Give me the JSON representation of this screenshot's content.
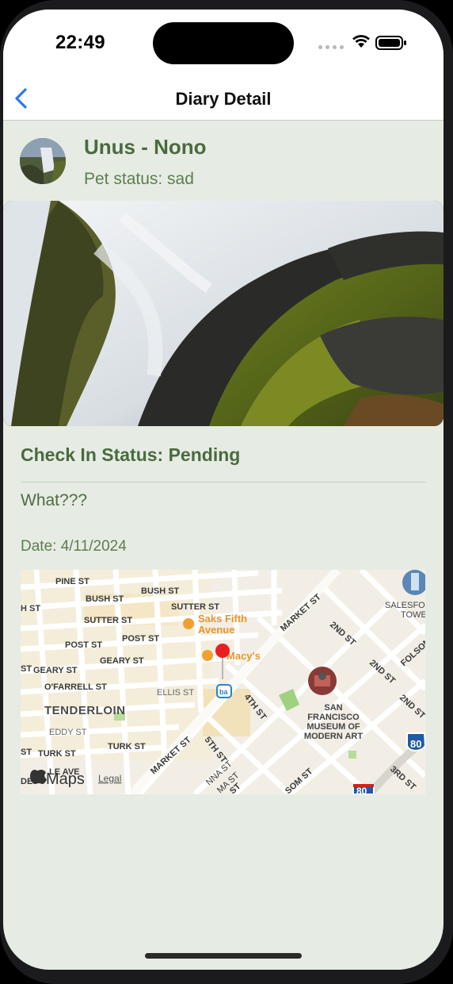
{
  "status_bar": {
    "time": "22:49",
    "icons": [
      "cellular-signal-icon",
      "wifi-icon",
      "battery-icon"
    ]
  },
  "nav": {
    "title": "Diary Detail",
    "back_icon": "chevron-left-icon",
    "accent": "#2a7be4"
  },
  "diary": {
    "owner_title": "Unus - Nono",
    "pet_status": "Pet status: sad",
    "check_in_status": "Check In Status: Pending",
    "note": "What???",
    "date": "Date: 4/11/2024"
  },
  "map": {
    "streets": [
      "PINE ST",
      "BUSH ST",
      "BUSH ST",
      "SUTTER ST",
      "SUTTER ST",
      "POST ST",
      "POST ST",
      "GEARY ST",
      "GEARY ST",
      "O'FARRELL ST",
      "ELLIS ST",
      "EDDY ST",
      "TURK ST",
      "TURK ST",
      "MARKET ST",
      "MARKET ST",
      "2ND ST",
      "2ND ST",
      "2ND ST",
      "4TH ST",
      "5TH ST",
      "3RD ST",
      "FOLSOM",
      "SOM ST",
      "H ST",
      "ST",
      "ST",
      "DE",
      "LE AVE",
      "NNA ST",
      "MA ST",
      "ST"
    ],
    "pois": [
      "Saks Fifth",
      "Avenue",
      "Macy's",
      "SAN",
      "FRANCISCO",
      "MUSEUM OF",
      "MODERN ART",
      "SALESFO",
      "TOWE"
    ],
    "neighborhood": "TENDERLOIN",
    "highway_shields": [
      "80",
      "80"
    ],
    "attribution": "Maps",
    "legal": "Legal"
  },
  "colors": {
    "background": "#e6ece4",
    "title_green": "#4b6a3f",
    "text_green": "#5e7d4f"
  }
}
